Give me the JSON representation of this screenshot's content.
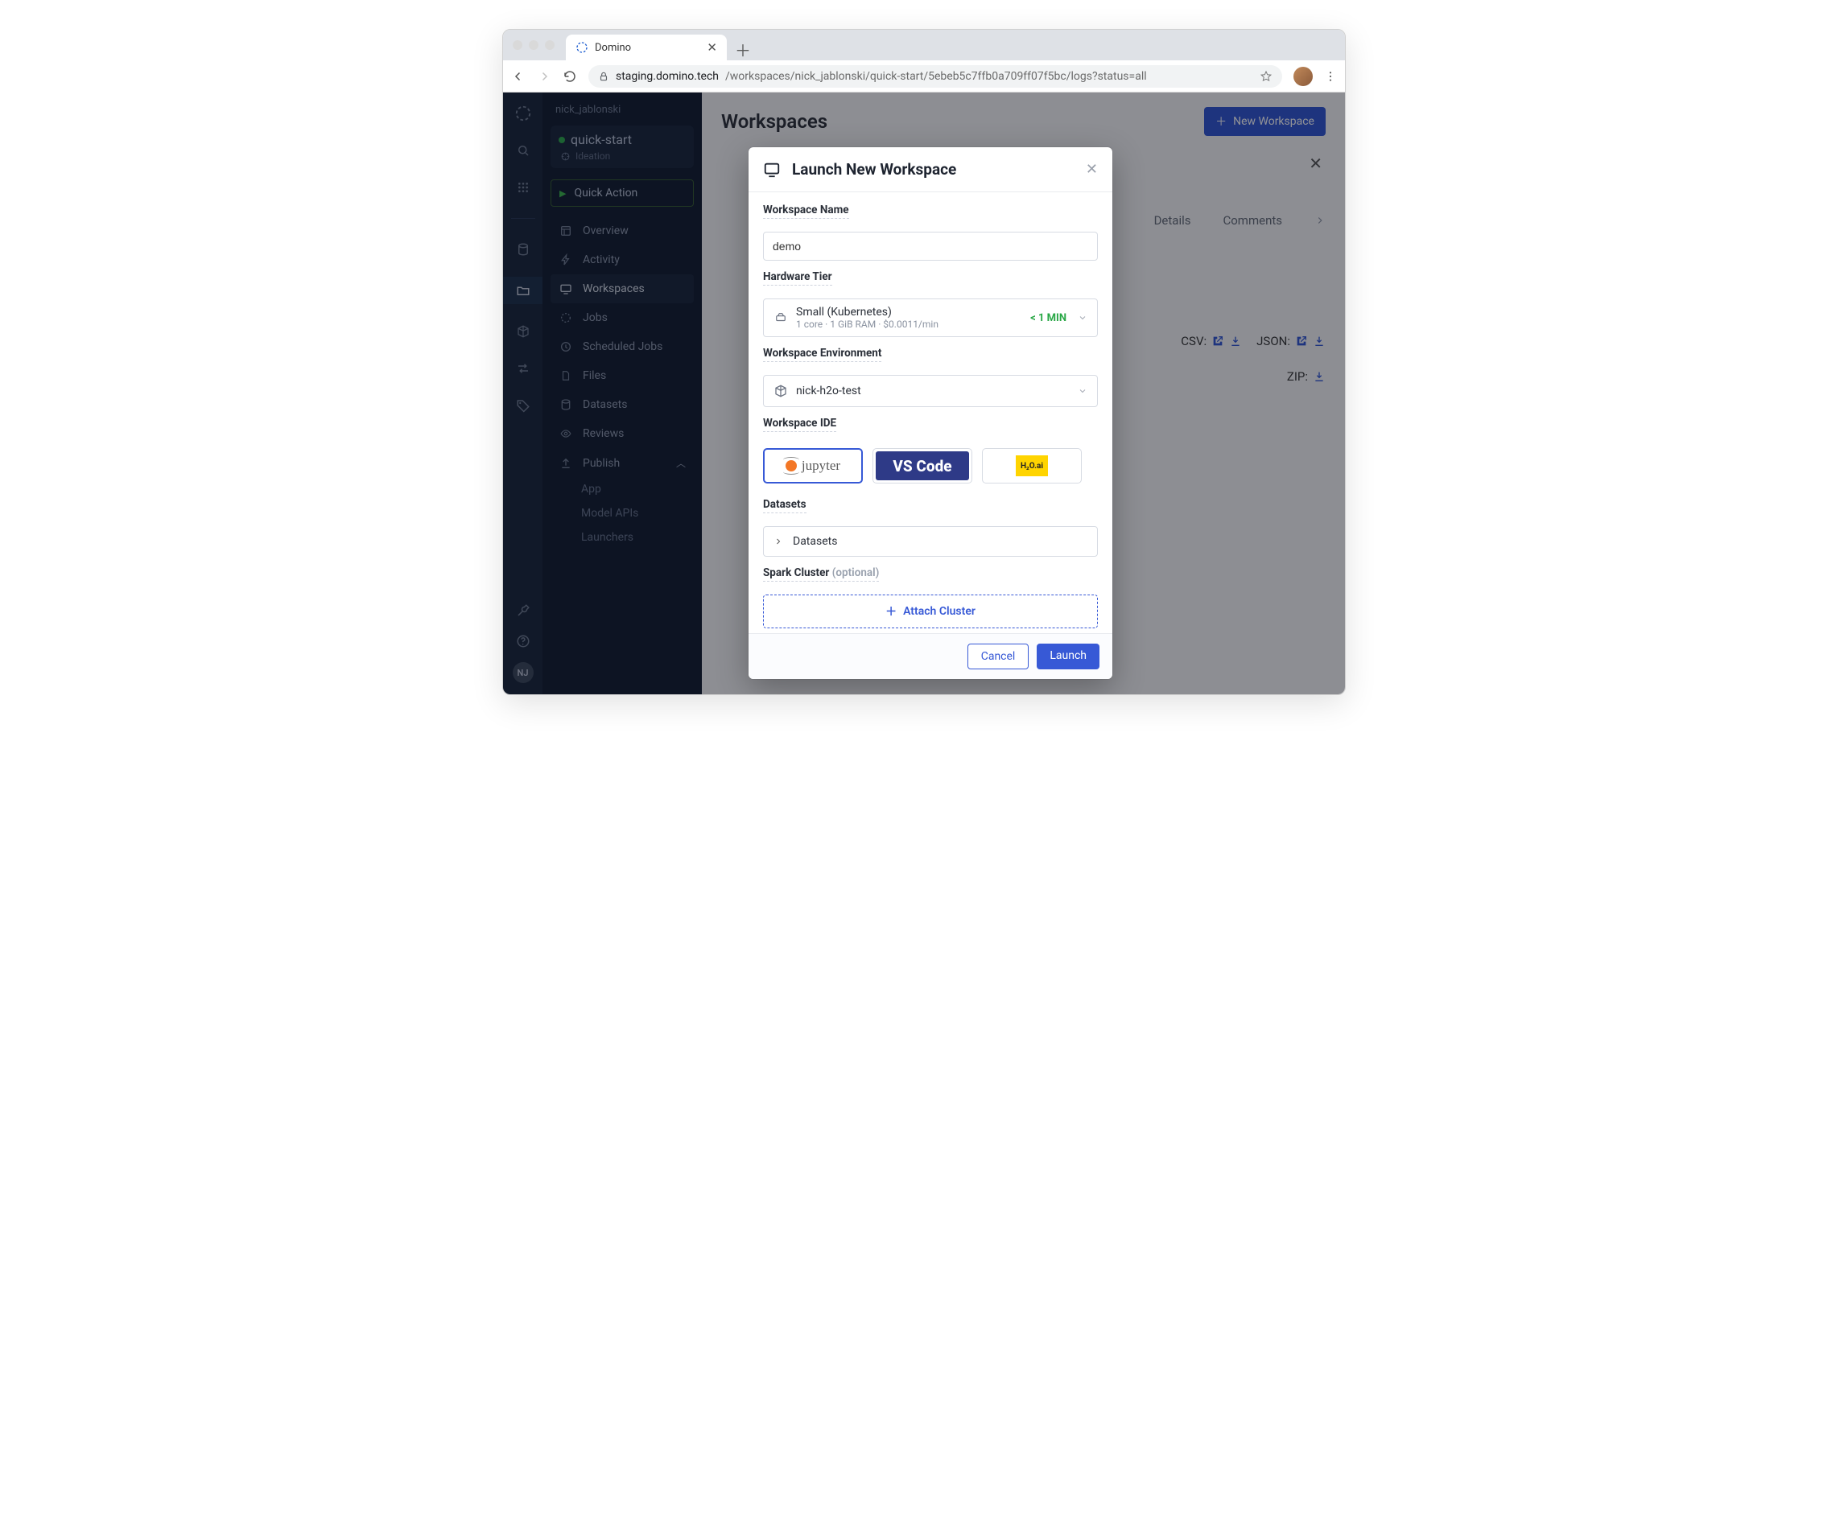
{
  "browser": {
    "tab_title": "Domino",
    "url_host": "staging.domino.tech",
    "url_path": "/workspaces/nick_jablonski/quick-start/5ebeb5c7ffb0a709ff07f5bc/logs?status=all"
  },
  "sidepanel": {
    "user": "nick_jablonski",
    "project": {
      "name": "quick-start",
      "phase": "Ideation"
    },
    "quick_action": "Quick Action",
    "items": {
      "overview": "Overview",
      "activity": "Activity",
      "workspaces": "Workspaces",
      "jobs": "Jobs",
      "scheduled": "Scheduled Jobs",
      "files": "Files",
      "datasets": "Datasets",
      "reviews": "Reviews",
      "publish": "Publish"
    },
    "publish_children": {
      "app": "App",
      "model_apis": "Model APIs",
      "launchers": "Launchers"
    },
    "avatar_initials": "NJ"
  },
  "page": {
    "title": "Workspaces",
    "new_button": "New Workspace",
    "tabs": {
      "details": "Details",
      "comments": "Comments"
    },
    "exports": {
      "csv": "CSV:",
      "json": "JSON:",
      "zip": "ZIP:"
    }
  },
  "modal": {
    "title": "Launch New Workspace",
    "labels": {
      "name": "Workspace Name",
      "hw": "Hardware Tier",
      "env": "Workspace Environment",
      "ide": "Workspace IDE",
      "datasets": "Datasets",
      "spark": "Spark Cluster",
      "optional": "(optional)"
    },
    "name_value": "demo",
    "hw": {
      "title": "Small (Kubernetes)",
      "sub": "1 core · 1 GiB RAM · $0.0011/min",
      "eta": "< 1 MIN"
    },
    "env": "nick-h2o-test",
    "ide_options": {
      "jupyter": "jupyter",
      "vscode": "VS Code",
      "h2o": "H₂O.ai"
    },
    "datasets_row": "Datasets",
    "attach": "Attach Cluster",
    "buttons": {
      "cancel": "Cancel",
      "launch": "Launch"
    }
  }
}
